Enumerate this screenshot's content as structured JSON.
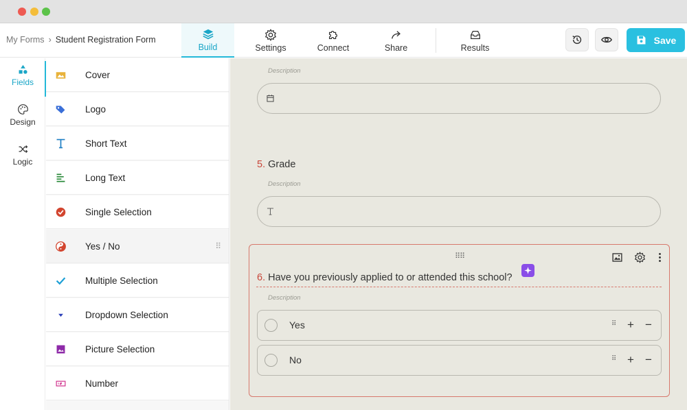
{
  "breadcrumb": {
    "root": "My Forms",
    "separator": "›",
    "current": "Student Registration Form"
  },
  "nav": {
    "build": "Build",
    "settings": "Settings",
    "connect": "Connect",
    "share": "Share",
    "results": "Results"
  },
  "save_label": "Save",
  "rail": {
    "fields": "Fields",
    "design": "Design",
    "logic": "Logic"
  },
  "field_types": [
    {
      "label": "Cover",
      "icon": "image-icon",
      "color": "#e8b23a"
    },
    {
      "label": "Logo",
      "icon": "tag-icon",
      "color": "#3a6fd8"
    },
    {
      "label": "Short Text",
      "icon": "text-t-icon",
      "color": "#1e7fc4"
    },
    {
      "label": "Long Text",
      "icon": "paragraph-icon",
      "color": "#2a8a3a"
    },
    {
      "label": "Single Selection",
      "icon": "check-circle-icon",
      "color": "#d2452f"
    },
    {
      "label": "Yes / No",
      "icon": "yin-yang-icon",
      "color": "#d2452f"
    },
    {
      "label": "Multiple Selection",
      "icon": "checkmark-icon",
      "color": "#1ea0d6"
    },
    {
      "label": "Dropdown Selection",
      "icon": "dropdown-arrow-icon",
      "color": "#2a3fb8"
    },
    {
      "label": "Picture Selection",
      "icon": "picture-icon",
      "color": "#8e2aa8"
    },
    {
      "label": "Number",
      "icon": "number-icon",
      "color": "#d0308c"
    }
  ],
  "form": {
    "date_question": {
      "description": "Description"
    },
    "grade_question": {
      "number": "5.",
      "title": "Grade",
      "description": "Description"
    },
    "yesno_question": {
      "number": "6.",
      "title": "Have you previously applied to or attended this school?",
      "description": "Description",
      "options": [
        "Yes",
        "No"
      ],
      "add_symbol": "+",
      "remove_symbol": "−"
    }
  },
  "colors": {
    "accent": "#22b8d8",
    "question_number": "#c8463a",
    "selected_border": "#d7786c",
    "canvas_bg": "#e9e8e0"
  }
}
